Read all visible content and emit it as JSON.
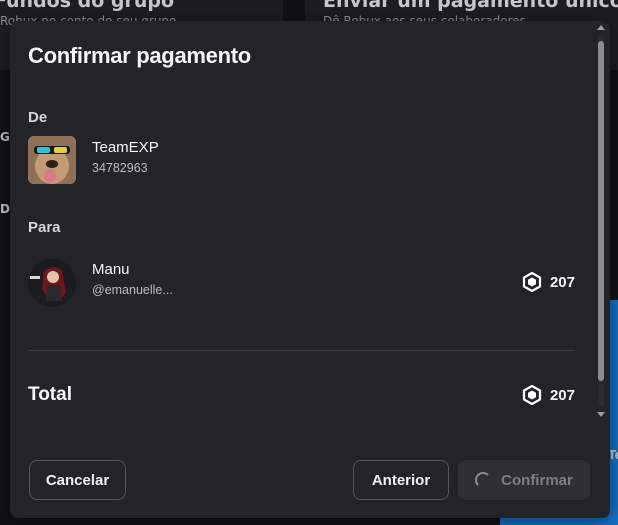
{
  "background": {
    "left_title": "Fundos do grupo",
    "left_subtitle": "Robux no conto do seu grupo",
    "right_title": "Enviar um pagamento único",
    "right_subtitle": "Dê Robux aos seus colaboradores",
    "frag_gr": "Gr",
    "frag_di": "Di",
    "frag_te": "Te"
  },
  "modal": {
    "title": "Confirmar pagamento",
    "from_label": "De",
    "from": {
      "name": "TeamEXP",
      "id": "34782963"
    },
    "to_label": "Para",
    "to": {
      "name": "Manu",
      "handle": "@emanuelle...",
      "amount": "207"
    },
    "total_label": "Total",
    "total_amount": "207",
    "buttons": {
      "cancel": "Cancelar",
      "previous": "Anterior",
      "confirm": "Confirmar"
    }
  },
  "icons": {
    "currency": "robux-icon",
    "loading": "spinner-icon"
  },
  "colors": {
    "modal_bg": "#232428",
    "page_bg": "#121215",
    "accent_blue": "#1473c7"
  }
}
